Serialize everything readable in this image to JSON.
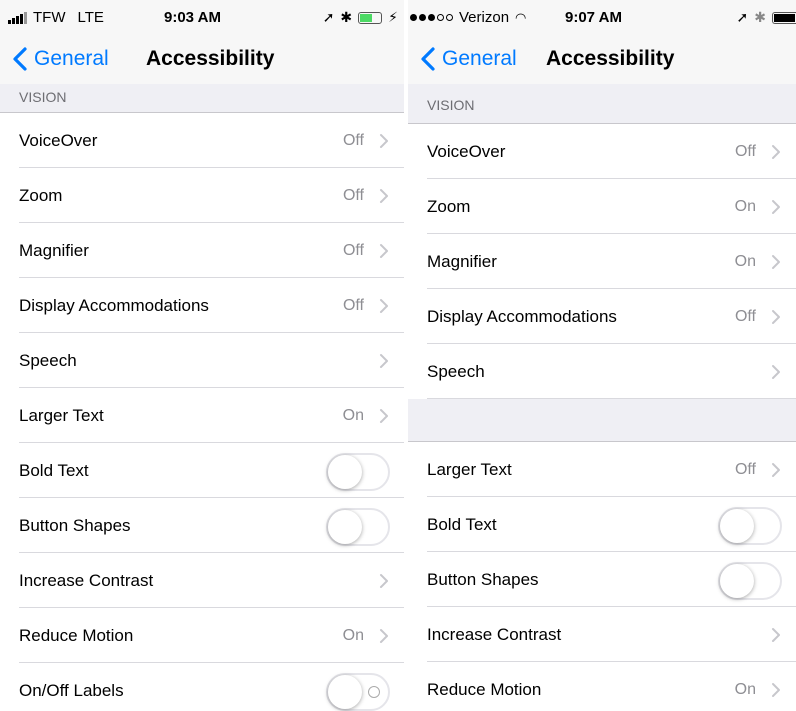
{
  "left": {
    "status": {
      "carrier": "TFW",
      "network": "LTE",
      "time": "9:03 AM"
    },
    "nav": {
      "back": "General",
      "title": "Accessibility"
    },
    "section": "VISION",
    "rows": [
      {
        "label": "VoiceOver",
        "value": "Off"
      },
      {
        "label": "Zoom",
        "value": "Off"
      },
      {
        "label": "Magnifier",
        "value": "Off"
      },
      {
        "label": "Display Accommodations",
        "value": "Off"
      },
      {
        "label": "Speech",
        "value": ""
      },
      {
        "label": "Larger Text",
        "value": "On"
      },
      {
        "label": "Bold Text",
        "toggle": "off"
      },
      {
        "label": "Button Shapes",
        "toggle": "off"
      },
      {
        "label": "Increase Contrast",
        "value": ""
      },
      {
        "label": "Reduce Motion",
        "value": "On"
      },
      {
        "label": "On/Off Labels",
        "toggle": "off-labels"
      }
    ]
  },
  "right": {
    "status": {
      "carrier": "Verizon",
      "time": "9:07 AM"
    },
    "nav": {
      "back": "General",
      "title": "Accessibility"
    },
    "section": "VISION",
    "rows": [
      {
        "label": "VoiceOver",
        "value": "Off"
      },
      {
        "label": "Zoom",
        "value": "On"
      },
      {
        "label": "Magnifier",
        "value": "On"
      },
      {
        "label": "Display Accommodations",
        "value": "Off"
      },
      {
        "label": "Speech",
        "value": ""
      },
      {
        "label": "Larger Text",
        "value": "Off"
      },
      {
        "label": "Bold Text",
        "toggle": "off"
      },
      {
        "label": "Button Shapes",
        "toggle": "off"
      },
      {
        "label": "Increase Contrast",
        "value": ""
      },
      {
        "label": "Reduce Motion",
        "value": "On"
      }
    ]
  },
  "colors": {
    "accent": "#007aff",
    "value_gray": "#8e8e93",
    "group_bg": "#efeff4",
    "battery_charging": "#4cd964"
  }
}
